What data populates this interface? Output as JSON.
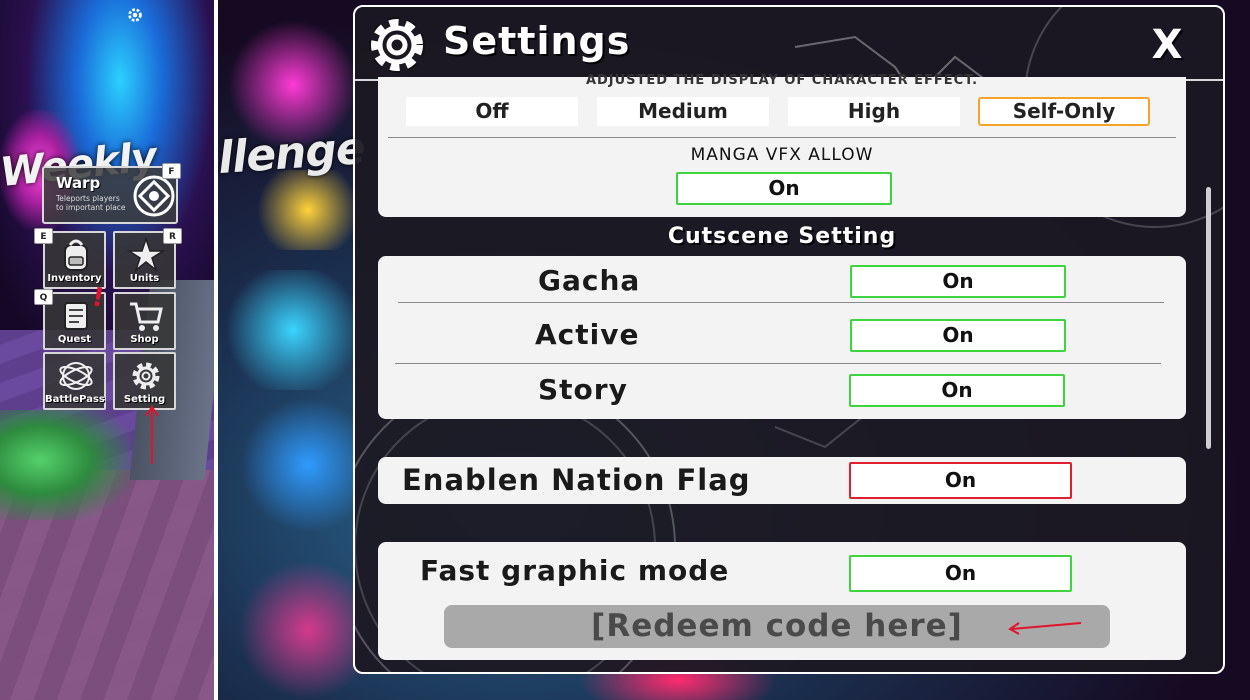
{
  "hud": {
    "warp": {
      "title": "Warp",
      "desc": "Teleports players to important place",
      "key": "F"
    },
    "buttons": [
      {
        "label": "Inventory",
        "key": "E"
      },
      {
        "label": "Units",
        "key": "R"
      },
      {
        "label": "Quest",
        "key": "Q"
      },
      {
        "label": "Shop",
        "key": ""
      },
      {
        "label": "BattlePass",
        "key": ""
      },
      {
        "label": "Setting",
        "key": ""
      }
    ],
    "alert": "!"
  },
  "background": {
    "banner_left": "Weekly",
    "banner_right": "llenge"
  },
  "settings": {
    "title": "Settings",
    "close": "X",
    "vfx": {
      "caption": "ADJUSTED THE DISPLAY OF CHARACTER EFFECT.",
      "options": [
        "Off",
        "Medium",
        "High",
        "Self-Only"
      ],
      "selected": "Self-Only",
      "manga_label": "MANGA VFX ALLOW",
      "manga_value": "On"
    },
    "cutscene": {
      "title": "Cutscene Setting",
      "rows": [
        {
          "label": "Gacha",
          "value": "On"
        },
        {
          "label": "Active",
          "value": "On"
        },
        {
          "label": "Story",
          "value": "On"
        }
      ]
    },
    "nation_flag": {
      "label": "Enablen Nation Flag",
      "value": "On"
    },
    "fast_graphic": {
      "label": "Fast graphic mode",
      "value": "On"
    },
    "redeem": {
      "placeholder": "[Redeem code here]"
    }
  },
  "colors": {
    "toggle_on_border": "#3ed43e",
    "toggle_red_border": "#e0202e",
    "selected_border": "#f4a428",
    "annotation_arrow": "#e0142b"
  }
}
